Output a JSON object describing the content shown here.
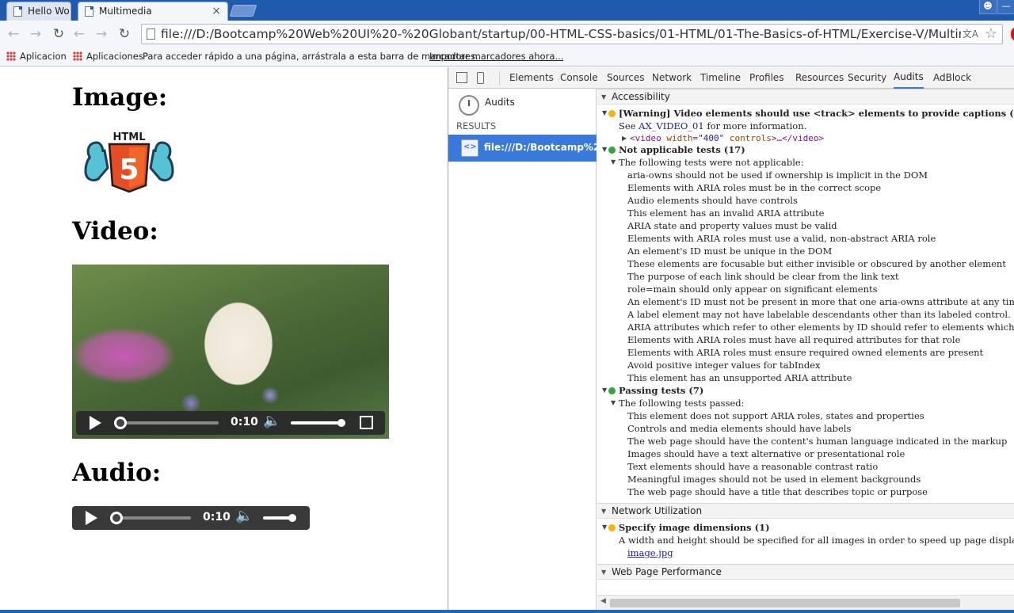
{
  "browser": {
    "tabs": [
      {
        "title": "Hello Wo",
        "active": false
      },
      {
        "title": "Multimedia",
        "active": true
      }
    ],
    "close_glyph": "×",
    "url": "file:///D:/Bootcamp%20Web%20UI%20-%20Globant/startup/00-HTML-CSS-basics/01-HTML/01-The-Basics-of-HTML/Exercise-V/Multimedia.ht",
    "bookmarks": {
      "apps_1": "Aplicaciones",
      "apps_2": "Aplicaciones",
      "hint": "Para acceder rápido a una página, arrástrala a esta barra de marcadores.",
      "import": "Importar marcadores ahora..."
    }
  },
  "page": {
    "image_heading": "Image:",
    "logo_text": "HTML",
    "logo_number": "5",
    "video_heading": "Video:",
    "audio_heading": "Audio:",
    "video_time": "0:10",
    "audio_time": "0:10"
  },
  "devtools": {
    "tabs": [
      "Elements",
      "Console",
      "Sources",
      "Network",
      "Timeline",
      "Profiles",
      "Resources",
      "Security",
      "Audits",
      "AdBlock"
    ],
    "selected_tab": "Audits",
    "sidebar": {
      "audits_label": "Audits",
      "results_label": "RESULTS",
      "result_item": "file:///D:/Bootcamp%20W"
    },
    "accessibility": {
      "header": "Accessibility",
      "warning_title": "[Warning] Video elements should use <track> elements to provide captions (1)",
      "see_prefix": "See ",
      "see_link": "AX_VIDEO_01",
      "see_suffix": " for more information.",
      "code_tag_open": "<video",
      "code_attr": "width",
      "code_val": "\"400\"",
      "code_attr2": "controls",
      "code_rest": ">…</video>",
      "not_applicable_title": "Not applicable tests (17)",
      "not_applicable_intro": "The following tests were not applicable:",
      "not_applicable_items": [
        "aria-owns should not be used if ownership is implicit in the DOM",
        "Elements with ARIA roles must be in the correct scope",
        "Audio elements should have controls",
        "This element has an invalid ARIA attribute",
        "ARIA state and property values must be valid",
        "Elements with ARIA roles must use a valid, non-abstract ARIA role",
        "An element's ID must be unique in the DOM",
        "These elements are focusable but either invisible or obscured by another element",
        "The purpose of each link should be clear from the link text",
        "role=main should only appear on significant elements",
        "An element's ID must not be present in more that one aria-owns attribute at any time",
        "A label element may not have labelable descendants other than its labeled control.",
        "ARIA attributes which refer to other elements by ID should refer to elements which exist in the",
        "Elements with ARIA roles must have all required attributes for that role",
        "Elements with ARIA roles must ensure required owned elements are present",
        "Avoid positive integer values for tabIndex",
        "This element has an unsupported ARIA attribute"
      ],
      "passing_title": "Passing tests (7)",
      "passing_intro": "The following tests passed:",
      "passing_items": [
        "This element does not support ARIA roles, states and properties",
        "Controls and media elements should have labels",
        "The web page should have the content's human language indicated in the markup",
        "Images should have a text alternative or presentational role",
        "Text elements should have a reasonable contrast ratio",
        "Meaningful images should not be used in element backgrounds",
        "The web page should have a title that describes topic or purpose"
      ]
    },
    "network": {
      "header": "Network Utilization",
      "title": "Specify image dimensions (1)",
      "description": "A width and height should be specified for all images in order to speed up page display. The fol",
      "file_link": "image.jpg"
    },
    "performance": {
      "header": "Web Page Performance"
    }
  },
  "colors": {
    "accent": "#3879d9",
    "warning_dot": "#f4b400",
    "pass_dot": "#2fa83a",
    "titlebar": "#1f5aad"
  },
  "icons": [
    "back-icon",
    "forward-icon",
    "reload-icon",
    "star-icon",
    "translate-icon",
    "play-icon",
    "speaker-icon",
    "fullscreen-icon",
    "inspect-icon",
    "device-icon",
    "audits-clock-icon"
  ]
}
